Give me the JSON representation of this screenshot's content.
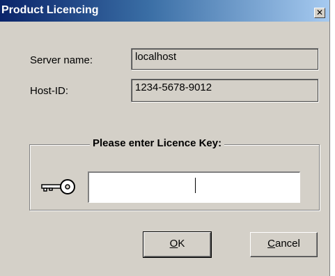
{
  "window": {
    "title": "Product Licencing",
    "close_glyph": "✕"
  },
  "fields": {
    "server_label": "Server name:",
    "server_value": "localhost",
    "hostid_label": "Host-ID:",
    "hostid_value": "1234-5678-9012"
  },
  "licence": {
    "group_title": "Please enter Licence Key:",
    "key_value": "",
    "icon": "key-icon"
  },
  "buttons": {
    "ok_mnemonic": "O",
    "ok_rest": "K",
    "cancel_mnemonic": "C",
    "cancel_rest": "ancel"
  },
  "colors": {
    "title_start": "#0a246a",
    "title_end": "#a6caf0",
    "face": "#d4d0c8"
  }
}
